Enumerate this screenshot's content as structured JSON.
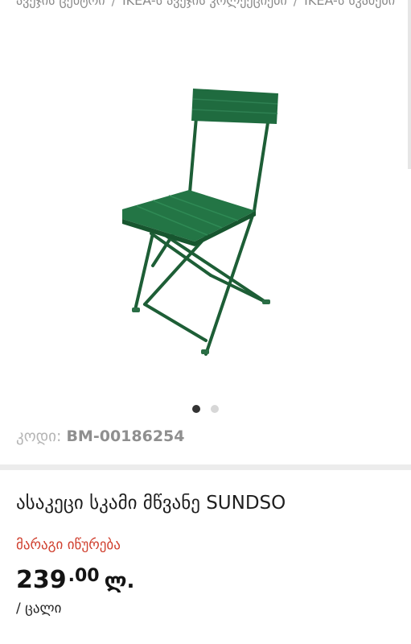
{
  "breadcrumb": {
    "items": [
      "ავეჯის ცენტრი",
      "IKEA-ს ავეჯის კოლექციები",
      "IKEA-ს სკამები"
    ],
    "separator": "/"
  },
  "product": {
    "code_label": "კოდი:",
    "code": "BM-00186254",
    "title": "ასაკეცი სკამი მწვანე SUNDSO",
    "stock_status": "მარაგი იწურება",
    "price_integer": "239",
    "price_decimal": ".00",
    "currency": "ლ.",
    "unit": "/ ცალი"
  },
  "gallery": {
    "slide_count": 2,
    "active_slide": 1,
    "image_alt": "green folding chair"
  },
  "colors": {
    "stock_red": "#d0402f",
    "chair_green": "#1f6b3f"
  }
}
